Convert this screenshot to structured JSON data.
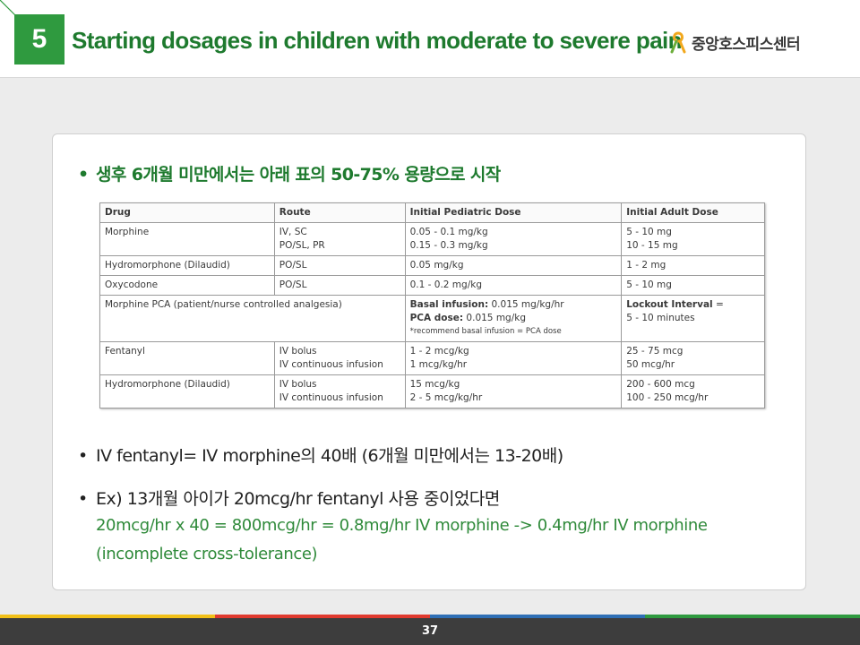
{
  "header": {
    "slide_number": "5",
    "title": "Starting dosages in children with moderate to severe pain",
    "brand": "중앙호스피스센터",
    "colors": {
      "green": "#2f9a3f",
      "title_green": "#1e7a2e"
    }
  },
  "content": {
    "bullet1": "생후 6개월 미만에서는 아래 표의 50-75% 용량으로 시작",
    "table": {
      "headers": [
        "Drug",
        "Route",
        "Initial Pediatric Dose",
        "Initial Adult Dose"
      ],
      "rows": [
        {
          "drug": "Morphine",
          "route": [
            "IV, SC",
            "PO/SL, PR"
          ],
          "ped": [
            "0.05 - 0.1 mg/kg",
            "0.15 - 0.3 mg/kg"
          ],
          "adult": [
            "5 - 10 mg",
            "10 - 15 mg"
          ]
        },
        {
          "drug": "Hydromorphone (Dilaudid)",
          "route": [
            "PO/SL"
          ],
          "ped": [
            "0.05 mg/kg"
          ],
          "adult": [
            "1 - 2 mg"
          ]
        },
        {
          "drug": "Oxycodone",
          "route": [
            "PO/SL"
          ],
          "ped": [
            "0.1 - 0.2 mg/kg"
          ],
          "adult": [
            "5 - 10 mg"
          ]
        },
        {
          "drug": "Morphine PCA (patient/nurse controlled analgesia)",
          "ped_basal_label": "Basal infusion:",
          "ped_basal": " 0.015 mg/kg/hr",
          "ped_pca_label": "PCA dose:",
          "ped_pca": " 0.015 mg/kg",
          "ped_note": "*recommend basal infusion = PCA dose",
          "adult_label": "Lockout Interval",
          "adult_suffix": " =",
          "adult_value": "5 - 10 minutes"
        },
        {
          "drug": "Fentanyl",
          "route": [
            "IV bolus",
            "IV continuous infusion"
          ],
          "ped": [
            "1 - 2 mcg/kg",
            "1 mcg/kg/hr"
          ],
          "adult": [
            "25 - 75 mcg",
            "50 mcg/hr"
          ]
        },
        {
          "drug": "Hydromorphone (Dilaudid)",
          "route": [
            "IV bolus",
            "IV continuous infusion"
          ],
          "ped": [
            "15 mcg/kg",
            "2 - 5 mcg/kg/hr"
          ],
          "adult": [
            "200 - 600 mcg",
            "100 - 250 mcg/hr"
          ]
        }
      ]
    },
    "bullet2": "IV fentanyl= IV morphine의 40배 (6개월 미만에서는 13-20배)",
    "bullet3": "Ex) 13개월 아이가 20mcg/hr fentanyl 사용 중이었다면",
    "sub_line1": "20mcg/hr x 40 = 800mcg/hr = 0.8mg/hr  IV morphine -> 0.4mg/hr IV morphine",
    "sub_line2": "(incomplete cross-tolerance)"
  },
  "footer": {
    "page_number": "37",
    "stripe_colors": [
      "#f2c018",
      "#e03a2f",
      "#2f6fb5",
      "#2f9a3f"
    ]
  }
}
